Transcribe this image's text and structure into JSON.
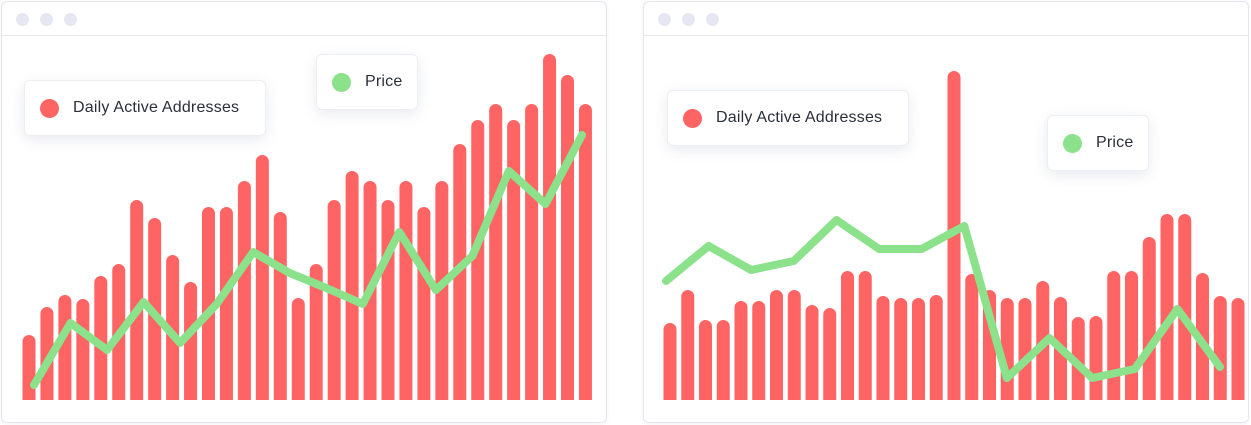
{
  "colors": {
    "bar": "#ff6464",
    "line": "#8be28b"
  },
  "chart_data": [
    {
      "type": "bar",
      "legend": {
        "bars": "Daily Active Addresses",
        "line": "Price"
      },
      "ylim": [
        0,
        350
      ],
      "bar_values": [
        65,
        93,
        105,
        101,
        124,
        136,
        200,
        182,
        145,
        118,
        193,
        193,
        219,
        245,
        188,
        102,
        136,
        200,
        229,
        219,
        200,
        219,
        193,
        219,
        256,
        280,
        296,
        280,
        296,
        346,
        325,
        296
      ],
      "line_values": [
        15,
        77,
        50,
        98,
        57,
        96,
        148,
        127,
        112,
        96,
        168,
        110,
        144,
        229,
        196,
        265
      ]
    },
    {
      "type": "bar",
      "legend": {
        "bars": "Daily Active Addresses",
        "line": "Price"
      },
      "ylim": [
        0,
        350
      ],
      "bar_values": [
        77,
        110,
        80,
        80,
        99,
        99,
        110,
        110,
        95,
        92,
        129,
        129,
        104,
        102,
        102,
        105,
        329,
        126,
        110,
        102,
        102,
        119,
        103,
        83,
        84,
        129,
        129,
        163,
        186,
        186,
        127,
        104,
        102
      ],
      "line_values": [
        119,
        154,
        130,
        139,
        180,
        151,
        151,
        174,
        22,
        62,
        22,
        31,
        91,
        33
      ]
    }
  ]
}
